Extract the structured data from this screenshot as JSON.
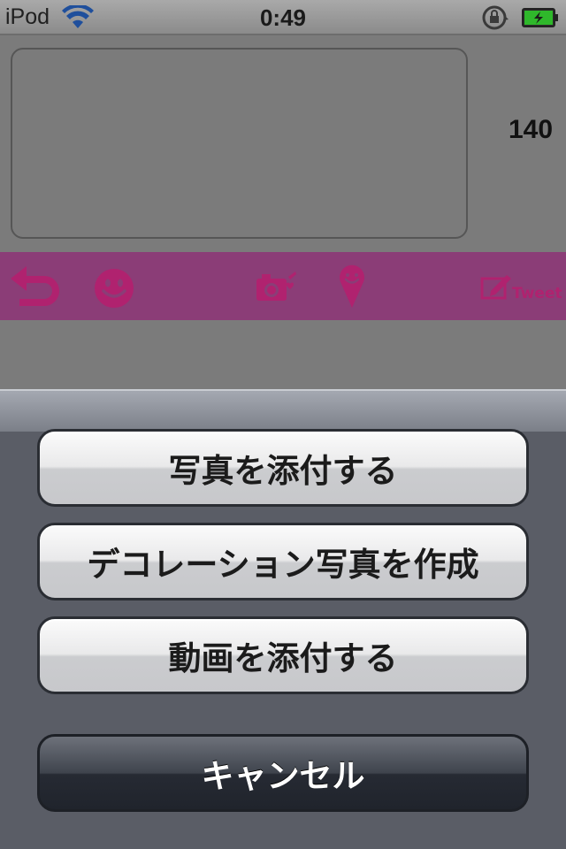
{
  "status_bar": {
    "carrier": "iPod",
    "time": "0:49"
  },
  "compose": {
    "char_count": "140"
  },
  "toolbar": {
    "icons": [
      "back-arrow-icon",
      "smiley-icon",
      "camera-heart-icon",
      "location-pin-icon",
      "tweet-compose-icon"
    ],
    "tweet_label": "Tweet",
    "accent": "#b0226f"
  },
  "action_sheet": {
    "buttons": [
      "写真を添付する",
      "デコレーション写真を作成",
      "動画を添付する"
    ],
    "cancel_label": "キャンセル"
  }
}
